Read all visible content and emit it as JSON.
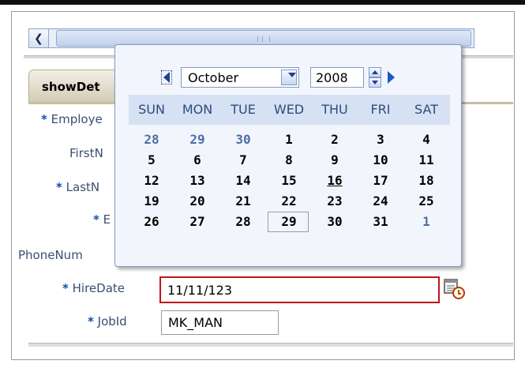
{
  "form": {
    "tab_label": "showDet",
    "fields": [
      {
        "label": "Employe",
        "required": true
      },
      {
        "label": "FirstN",
        "required": false
      },
      {
        "label": "LastN",
        "required": true
      },
      {
        "label": "E",
        "required": true
      },
      {
        "label": "PhoneNum",
        "required": false
      },
      {
        "label": "HireDate",
        "required": true,
        "value": "11/11/123",
        "error": true
      },
      {
        "label": "JobId",
        "required": true,
        "value": "MK_MAN"
      }
    ]
  },
  "calendar": {
    "month": "October",
    "year": "2008",
    "weekdays": [
      "SUN",
      "MON",
      "TUE",
      "WED",
      "THU",
      "FRI",
      "SAT"
    ],
    "weeks": [
      [
        {
          "d": "28",
          "t": "other"
        },
        {
          "d": "29",
          "t": "other"
        },
        {
          "d": "30",
          "t": "other"
        },
        {
          "d": "1"
        },
        {
          "d": "2"
        },
        {
          "d": "3"
        },
        {
          "d": "4"
        }
      ],
      [
        {
          "d": "5"
        },
        {
          "d": "6"
        },
        {
          "d": "7"
        },
        {
          "d": "8"
        },
        {
          "d": "9"
        },
        {
          "d": "10"
        },
        {
          "d": "11"
        }
      ],
      [
        {
          "d": "12"
        },
        {
          "d": "13"
        },
        {
          "d": "14"
        },
        {
          "d": "15"
        },
        {
          "d": "16",
          "t": "today"
        },
        {
          "d": "17"
        },
        {
          "d": "18"
        }
      ],
      [
        {
          "d": "19"
        },
        {
          "d": "20"
        },
        {
          "d": "21"
        },
        {
          "d": "22"
        },
        {
          "d": "23"
        },
        {
          "d": "24"
        },
        {
          "d": "25"
        }
      ],
      [
        {
          "d": "26"
        },
        {
          "d": "27"
        },
        {
          "d": "28"
        },
        {
          "d": "29",
          "t": "selected"
        },
        {
          "d": "30"
        },
        {
          "d": "31"
        },
        {
          "d": "1",
          "t": "other"
        }
      ]
    ]
  },
  "icons": {
    "scroll_left": "chevron-left-icon",
    "cal_prev": "triangle-left-icon",
    "cal_next": "triangle-right-icon",
    "dropdown": "chevron-down-icon",
    "date_picker": "calendar-clock-icon"
  },
  "colors": {
    "error_border": "#c01418",
    "required_star": "#0d4fb1",
    "label_text": "#3a4f70",
    "calendar_header_bg": "#d6e2f3",
    "other_month_day": "#4d6fa6"
  }
}
